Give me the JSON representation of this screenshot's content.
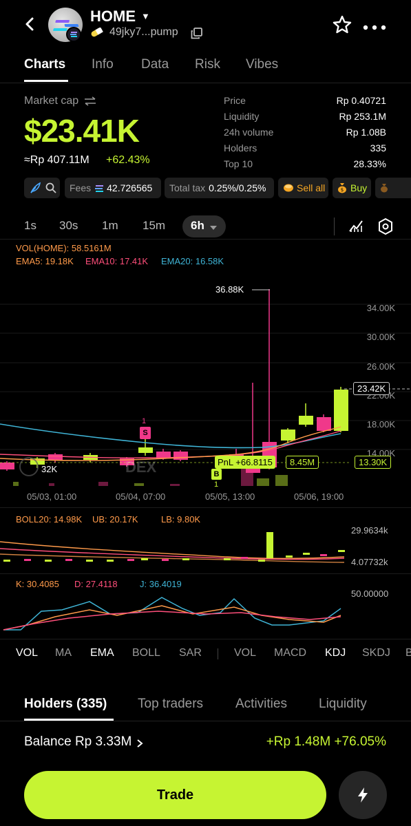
{
  "header": {
    "title": "HOME",
    "address": "49jky7...pump"
  },
  "tabs": [
    "Charts",
    "Info",
    "Data",
    "Risk",
    "Vibes"
  ],
  "market": {
    "label": "Market cap",
    "value": "$23.41K",
    "rp_value": "≈Rp 407.11M",
    "change": "+62.43%"
  },
  "stats": [
    {
      "label": "Price",
      "value": "Rp 0.40721"
    },
    {
      "label": "Liquidity",
      "value": "Rp 253.1M"
    },
    {
      "label": "24h volume",
      "value": "Rp 1.08B"
    },
    {
      "label": "Holders",
      "value": "335"
    },
    {
      "label": "Top 10",
      "value": "28.33%"
    }
  ],
  "chips": {
    "fees_label": "Fees",
    "fees_value": "42.726565",
    "total_tax_label": "Total tax",
    "total_tax_value": "0.25%/0.25%",
    "sell_all": "Sell all",
    "buy": "Buy"
  },
  "intervals": [
    "1s",
    "30s",
    "1m",
    "15m",
    "6h"
  ],
  "chart": {
    "vol_label": "VOL(HOME): 58.5161M",
    "ema5": "EMA5: 19.18K",
    "ema10": "EMA10: 17.41K",
    "ema20": "EMA20: 16.58K",
    "peak_label": "36.88K",
    "y_ticks": [
      "34.00K",
      "30.00K",
      "26.00K",
      "22.00K",
      "18.00K",
      "14.00K"
    ],
    "current_price": "23.42K",
    "marker_price": "13.30K",
    "pnl_label": "PnL +66.8115",
    "pnl_amount": "8.45M",
    "left_value": "32K",
    "marker_s": "S",
    "marker_b": "B",
    "marker_count_1": "1",
    "marker_count_2": "1",
    "watermark": "DEX",
    "x_ticks": [
      "05/03, 01:00",
      "05/04, 07:00",
      "05/05, 13:00",
      "05/06, 19:00"
    ]
  },
  "boll": {
    "boll20": "BOLL20: 14.98K",
    "ub": "UB: 20.17K",
    "lb": "LB: 9.80K",
    "top_value": "29.9634k",
    "bottom_value": "4.07732k"
  },
  "kdj": {
    "k": "K: 30.4085",
    "d": "D: 27.4118",
    "j": "J: 36.4019",
    "level": "50.00000"
  },
  "indicators": [
    "VOL",
    "MA",
    "EMA",
    "BOLL",
    "SAR",
    "VOL",
    "MACD",
    "KDJ",
    "SKDJ",
    "B"
  ],
  "bottom_tabs": [
    "Holders (335)",
    "Top traders",
    "Activities",
    "Liquidity"
  ],
  "balance": {
    "label": "Balance Rp 3.33M",
    "pnl": "+Rp 1.48M +76.05%"
  },
  "trade_label": "Trade",
  "colors": {
    "accent": "#c6f432",
    "bear": "#f0388a",
    "ema5": "#ff9a4a",
    "ema10": "#ff4f7b",
    "ema20": "#3fb4d6"
  }
}
